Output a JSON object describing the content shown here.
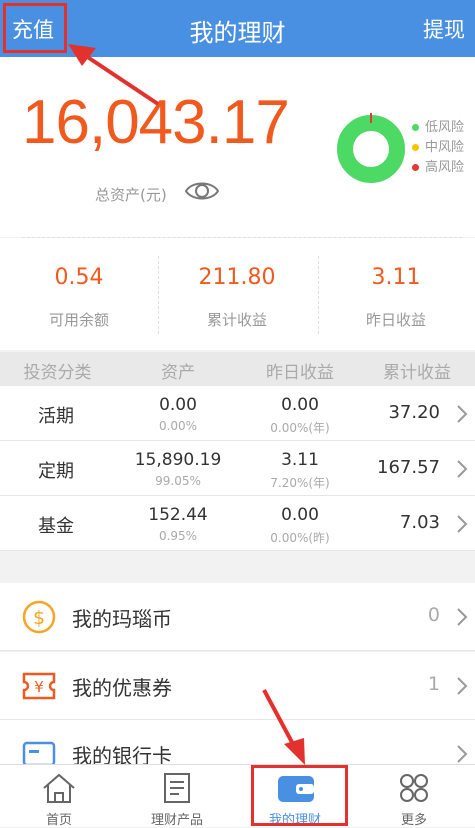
{
  "header": {
    "left_action": "充值",
    "title": "我的理财",
    "right_action": "提现"
  },
  "summary": {
    "total_assets": "16,043.17",
    "total_label": "总资产(元)",
    "risk_legend": [
      {
        "label": "低风险",
        "color": "#4cd964"
      },
      {
        "label": "中风险",
        "color": "#f5c400"
      },
      {
        "label": "高风险",
        "color": "#e53935"
      }
    ],
    "risk_share": {
      "low": 0.99,
      "medium": 0.0,
      "high": 0.01
    }
  },
  "stats": [
    {
      "value": "0.54",
      "label": "可用余额"
    },
    {
      "value": "211.80",
      "label": "累计收益"
    },
    {
      "value": "3.11",
      "label": "昨日收益"
    }
  ],
  "table": {
    "headers": [
      "投资分类",
      "资产",
      "昨日收益",
      "累计收益"
    ],
    "rows": [
      {
        "name": "活期",
        "asset": "0.00",
        "asset_pct": "0.00%",
        "yesterday": "0.00",
        "yesterday_sub": "0.00%(年)",
        "cumulative": "37.20"
      },
      {
        "name": "定期",
        "asset": "15,890.19",
        "asset_pct": "99.05%",
        "yesterday": "3.11",
        "yesterday_sub": "7.20%(年)",
        "cumulative": "167.57"
      },
      {
        "name": "基金",
        "asset": "152.44",
        "asset_pct": "0.95%",
        "yesterday": "0.00",
        "yesterday_sub": "0.00%(昨)",
        "cumulative": "7.03"
      }
    ]
  },
  "menu": [
    {
      "label": "我的玛瑙币",
      "value": "0",
      "icon": "coin-icon"
    },
    {
      "label": "我的优惠券",
      "value": "1",
      "icon": "coupon-icon"
    },
    {
      "label": "我的银行卡",
      "value": "",
      "icon": "bank-card-icon"
    }
  ],
  "tabbar": [
    {
      "label": "首页",
      "icon": "home-icon"
    },
    {
      "label": "理财产品",
      "icon": "document-icon"
    },
    {
      "label": "我的理财",
      "icon": "wallet-icon"
    },
    {
      "label": "更多",
      "icon": "more-icon"
    }
  ],
  "colors": {
    "accent": "#4a90e2",
    "orange": "#f05a1e",
    "highlight": "#e3322e"
  }
}
